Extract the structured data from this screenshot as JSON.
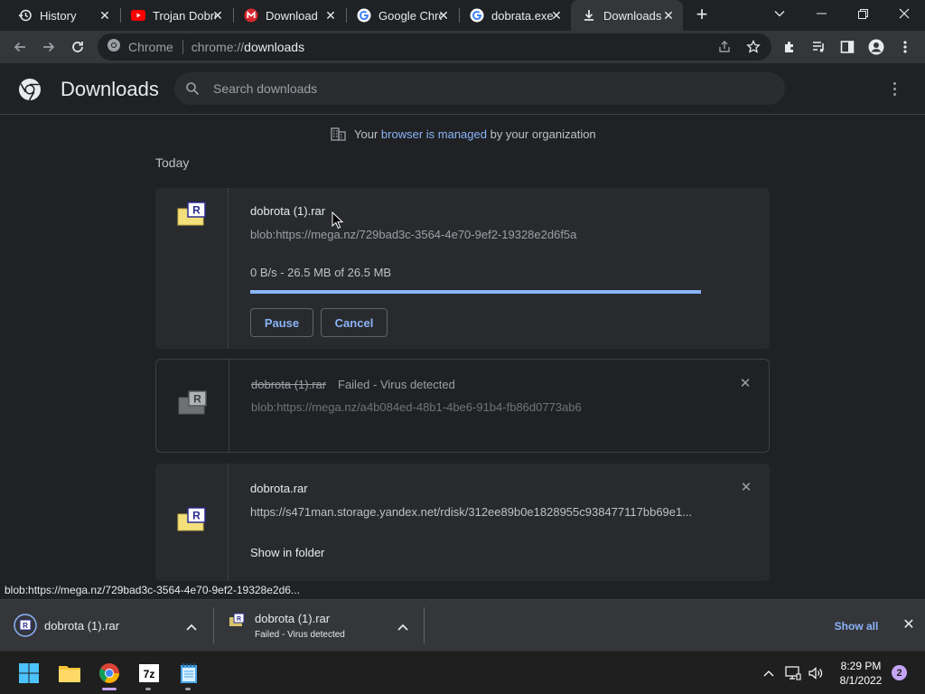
{
  "tabs": [
    {
      "title": "History",
      "icon": "history-icon"
    },
    {
      "title": "Trojan Dobrota",
      "icon": "youtube-icon"
    },
    {
      "title": "Download",
      "icon": "mega-icon"
    },
    {
      "title": "Google Chrome",
      "icon": "google-icon"
    },
    {
      "title": "dobrata.exe",
      "icon": "google-icon"
    },
    {
      "title": "Downloads",
      "icon": "download-icon"
    }
  ],
  "omnibox": {
    "site_label": "Chrome",
    "url_scheme": "chrome://",
    "url_path": "downloads"
  },
  "page": {
    "title": "Downloads",
    "search_placeholder": "Search downloads"
  },
  "managed": {
    "prefix": "Your",
    "link": "browser is managed",
    "suffix": "by your organization"
  },
  "date_header": "Today",
  "downloads": [
    {
      "name": "dobrota (1).rar",
      "url": "blob:https://mega.nz/729bad3c-3564-4e70-9ef2-19328e2d6f5a",
      "progress_text": "0 B/s - 26.5 MB of 26.5 MB",
      "progress_fraction": 1.0,
      "pause_label": "Pause",
      "cancel_label": "Cancel"
    },
    {
      "name": "dobrota (1).rar",
      "status": "Failed - Virus detected",
      "url": "blob:https://mega.nz/a4b084ed-48b1-4be6-91b4-fb86d0773ab6"
    },
    {
      "name": "dobrota.rar",
      "url": "https://s471man.storage.yandex.net/rdisk/312ee89b0e1828955c938477117bb69e1...",
      "show_in_folder": "Show in folder"
    }
  ],
  "status_bar": "blob:https://mega.nz/729bad3c-3564-4e70-9ef2-19328e2d6...",
  "shelf": {
    "items": [
      {
        "name": "dobrota (1).rar"
      },
      {
        "name": "dobrota (1).rar",
        "sub": "Failed - Virus detected"
      }
    ],
    "show_all": "Show all"
  },
  "taskbar": {
    "time": "8:29 PM",
    "date": "8/1/2022",
    "notifications": "2",
    "apps": [
      "windows-start-icon",
      "file-explorer-icon",
      "chrome-icon",
      "7zip-icon",
      "notepad-icon"
    ]
  },
  "colors": {
    "accent": "#8ab4f8",
    "background": "#202124",
    "toolbar": "#35363a"
  }
}
